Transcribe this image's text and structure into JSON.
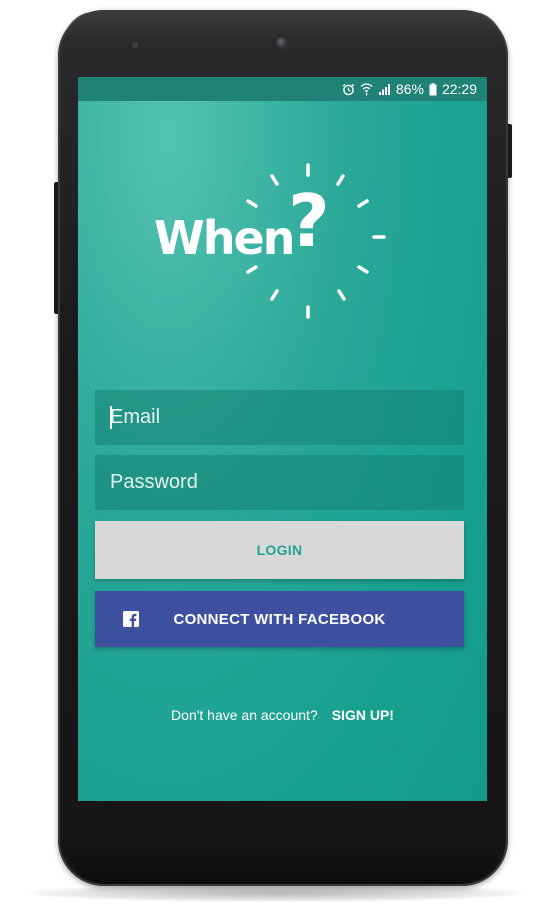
{
  "statusbar": {
    "battery_text": "86%",
    "time": "22:29",
    "icons": [
      "alarm-icon",
      "wifi-icon",
      "signal-icon",
      "battery-icon"
    ]
  },
  "app": {
    "logo_text": "When",
    "logo_mark": "?"
  },
  "login_form": {
    "email_placeholder": "Email",
    "password_placeholder": "Password",
    "login_label": "LOGIN",
    "facebook_label": "CONNECT WITH FACEBOOK",
    "facebook_icon": "facebook-icon"
  },
  "signup": {
    "prompt": "Don't have an account?",
    "link_label": "SIGN UP!"
  },
  "colors": {
    "accent": "#1ea492",
    "facebook_blue": "#3e50a0",
    "login_button_bg": "#d7d8d7",
    "statusbar_bg": "#1f8275"
  }
}
